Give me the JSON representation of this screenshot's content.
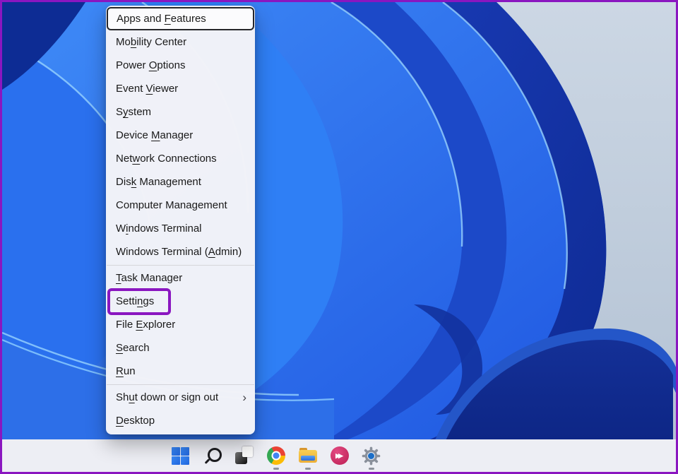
{
  "app": "windows-11-winx-menu-screenshot",
  "palette": {
    "annotation_purple": "#8a16c0",
    "frame_purple": "#8a16c0",
    "menu_background": "#f3f3f8",
    "menu_text": "#191919",
    "taskbar_background": "#edeef4",
    "wallpaper_light": "#c3cfdd",
    "wallpaper_blue": "#2a6df0",
    "wallpaper_navy": "#0d2c94"
  },
  "menu": {
    "items": [
      {
        "type": "item",
        "label": "Apps and Features",
        "underline_index": 9,
        "focused": true
      },
      {
        "type": "item",
        "label": "Mobility Center",
        "underline_index": 2
      },
      {
        "type": "item",
        "label": "Power Options",
        "underline_index": 6
      },
      {
        "type": "item",
        "label": "Event Viewer",
        "underline_index": 6
      },
      {
        "type": "item",
        "label": "System",
        "underline_index": 1
      },
      {
        "type": "item",
        "label": "Device Manager",
        "underline_index": 7
      },
      {
        "type": "item",
        "label": "Network Connections",
        "underline_index": 3
      },
      {
        "type": "item",
        "label": "Disk Management",
        "underline_index": 3
      },
      {
        "type": "item",
        "label": "Computer Management",
        "underline_index": -1
      },
      {
        "type": "item",
        "label": "Windows Terminal",
        "underline_index": 1
      },
      {
        "type": "item",
        "label": "Windows Terminal (Admin)",
        "underline_index": 18
      },
      {
        "type": "separator"
      },
      {
        "type": "item",
        "label": "Task Manager",
        "underline_index": 0
      },
      {
        "type": "item",
        "label": "Settings",
        "underline_index": 5,
        "annotated": true
      },
      {
        "type": "item",
        "label": "File Explorer",
        "underline_index": 5
      },
      {
        "type": "item",
        "label": "Search",
        "underline_index": 0
      },
      {
        "type": "item",
        "label": "Run",
        "underline_index": 0
      },
      {
        "type": "separator"
      },
      {
        "type": "item",
        "label": "Shut down or sign out",
        "underline_index": 2,
        "chevron": "›"
      },
      {
        "type": "item",
        "label": "Desktop",
        "underline_index": 0
      }
    ]
  },
  "annotation": {
    "target": "Settings",
    "shape": "rectangle",
    "color": "#8a16c0"
  },
  "taskbar": {
    "icons": [
      {
        "name": "windows-start",
        "running": false
      },
      {
        "name": "search",
        "running": false
      },
      {
        "name": "task-view",
        "running": false
      },
      {
        "name": "chrome",
        "running": true
      },
      {
        "name": "file-explorer",
        "running": true
      },
      {
        "name": "pink-app",
        "running": false,
        "glyph": "▶▶"
      },
      {
        "name": "settings",
        "running": true
      }
    ]
  }
}
